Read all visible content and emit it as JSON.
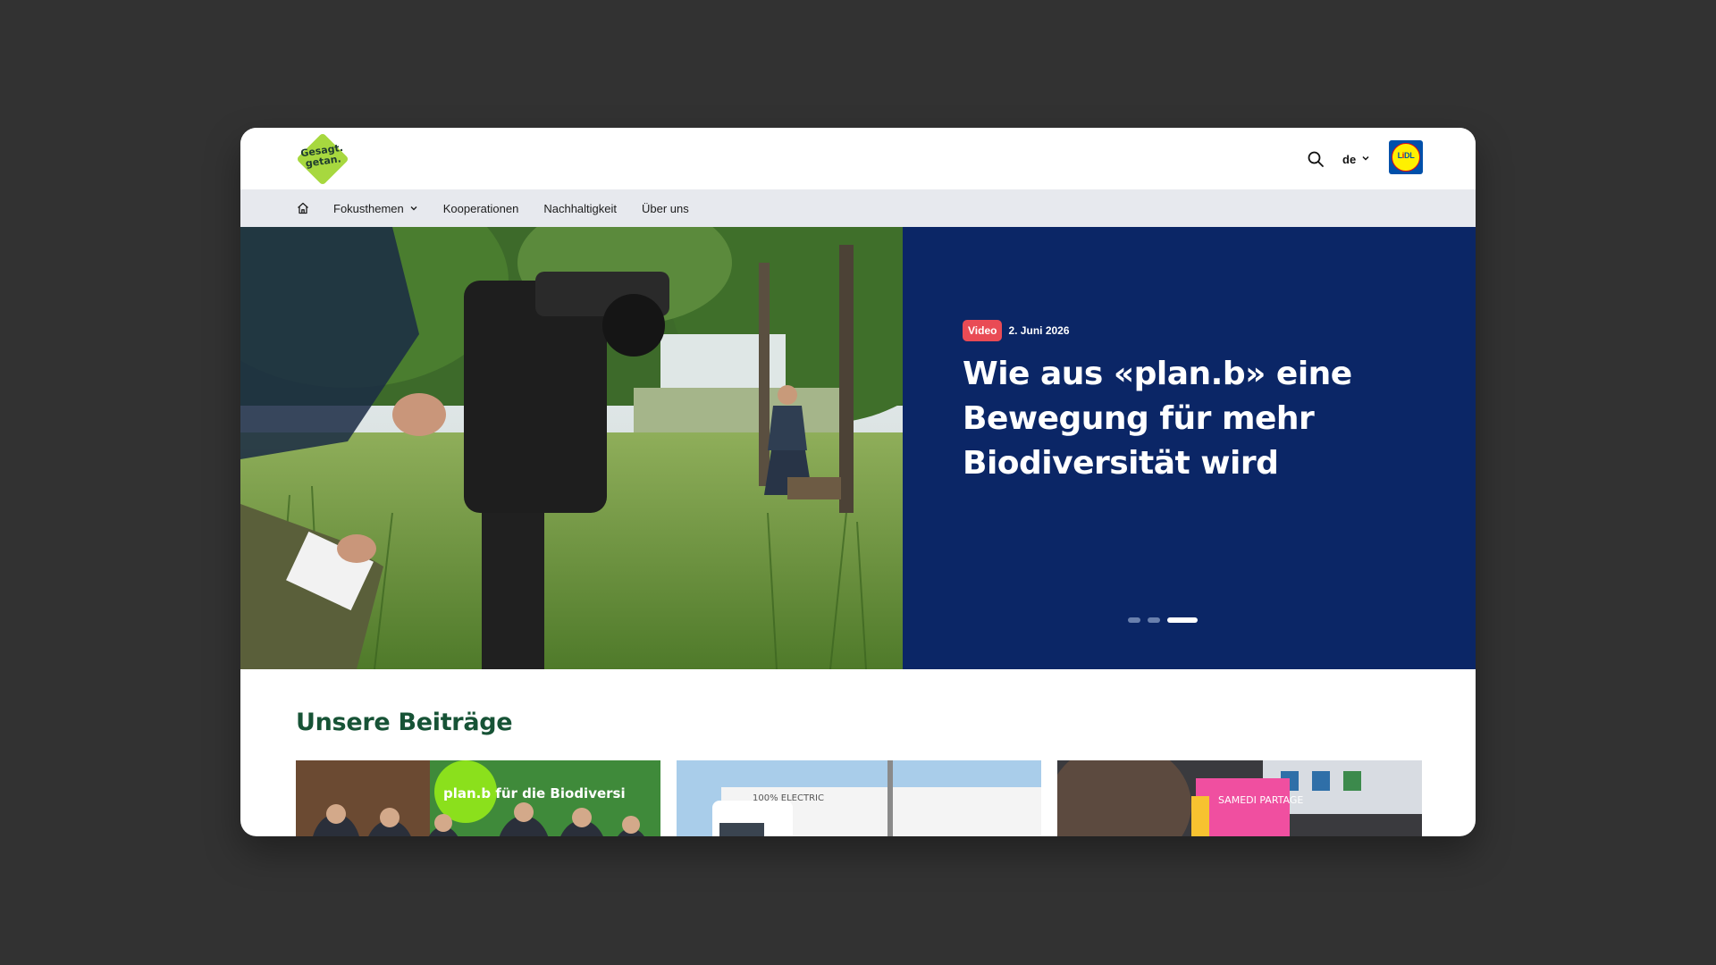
{
  "header": {
    "logo_text": "Gesagt. getan.",
    "search_icon": "search-icon",
    "language": "de",
    "brand_logo_text": "LIDL"
  },
  "nav": {
    "home_icon": "home-icon",
    "items": [
      {
        "label": "Fokusthemen",
        "has_dropdown": true
      },
      {
        "label": "Kooperationen",
        "has_dropdown": false
      },
      {
        "label": "Nachhaltigkeit",
        "has_dropdown": false
      },
      {
        "label": "Über uns",
        "has_dropdown": false
      }
    ]
  },
  "hero": {
    "badge": "Video",
    "date": "2. Juni 2026",
    "title": "Wie aus «plan.b» eine Bewegung für mehr Biodiversität wird",
    "slides_total": 3,
    "active_slide": 3
  },
  "articles": {
    "title": "Unsere Beiträge",
    "cards": [
      {
        "image_text": "plan.b für die Biodiversi"
      },
      {
        "image_text": "100% ELECTRIC"
      },
      {
        "image_text": "SAMEDI PARTAGE"
      }
    ]
  },
  "colors": {
    "background": "#323232",
    "nav_bg": "#e7e9ee",
    "hero_panel": "#0b2666",
    "badge": "#e94b55",
    "section_title": "#175336",
    "logo_green": "#a7d83f"
  }
}
